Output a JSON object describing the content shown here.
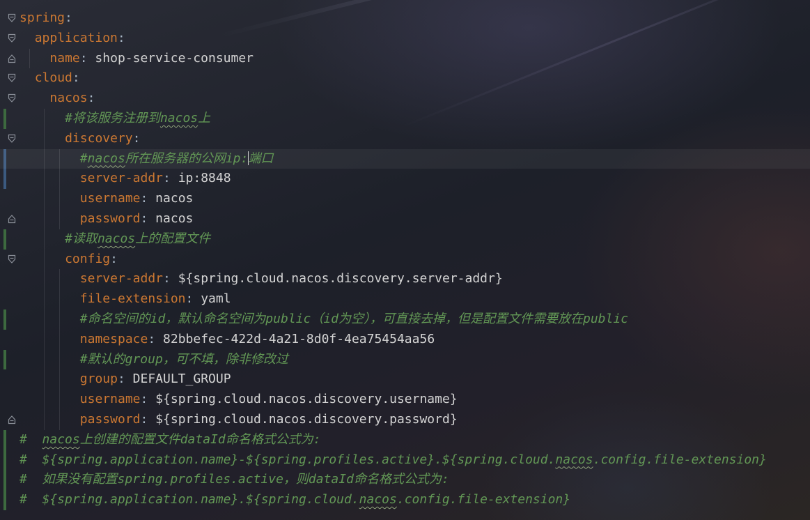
{
  "editor": {
    "language": "yaml",
    "caret_line": 8,
    "lines": [
      {
        "type": "key",
        "indent": 0,
        "key": "spring",
        "value": ""
      },
      {
        "type": "key",
        "indent": 1,
        "key": "application",
        "value": ""
      },
      {
        "type": "key",
        "indent": 2,
        "key": "name",
        "value": "shop-service-consumer"
      },
      {
        "type": "key",
        "indent": 1,
        "key": "cloud",
        "value": ""
      },
      {
        "type": "key",
        "indent": 2,
        "key": "nacos",
        "value": ""
      },
      {
        "type": "comment",
        "indent": 3,
        "text": "#将该服务注册到nacos上"
      },
      {
        "type": "key",
        "indent": 3,
        "key": "discovery",
        "value": ""
      },
      {
        "type": "comment",
        "indent": 4,
        "text": "#nacos所在服务器的公网ip:端口"
      },
      {
        "type": "key",
        "indent": 4,
        "key": "server-addr",
        "value": "ip:8848"
      },
      {
        "type": "key",
        "indent": 4,
        "key": "username",
        "value": "nacos"
      },
      {
        "type": "key",
        "indent": 4,
        "key": "password",
        "value": "nacos"
      },
      {
        "type": "comment",
        "indent": 3,
        "text": "#读取nacos上的配置文件"
      },
      {
        "type": "key",
        "indent": 3,
        "key": "config",
        "value": ""
      },
      {
        "type": "key",
        "indent": 4,
        "key": "server-addr",
        "value": "${spring.cloud.nacos.discovery.server-addr}"
      },
      {
        "type": "key",
        "indent": 4,
        "key": "file-extension",
        "value": "yaml"
      },
      {
        "type": "comment",
        "indent": 4,
        "text": "#命名空间的id，默认命名空间为public（id为空），可直接去掉，但是配置文件需要放在public"
      },
      {
        "type": "key",
        "indent": 4,
        "key": "namespace",
        "value": "82bbefec-422d-4a21-8d0f-4ea75454aa56"
      },
      {
        "type": "comment",
        "indent": 4,
        "text": "#默认的group，可不填，除非修改过"
      },
      {
        "type": "key",
        "indent": 4,
        "key": "group",
        "value": "DEFAULT_GROUP"
      },
      {
        "type": "key",
        "indent": 4,
        "key": "username",
        "value": "${spring.cloud.nacos.discovery.username}"
      },
      {
        "type": "key",
        "indent": 4,
        "key": "password",
        "value": "${spring.cloud.nacos.discovery.password}"
      },
      {
        "type": "comment",
        "indent": 0,
        "text": "#  nacos上创建的配置文件dataId命名格式公式为:"
      },
      {
        "type": "comment",
        "indent": 0,
        "text": "#  ${spring.application.name}-${spring.profiles.active}.${spring.cloud.nacos.config.file-extension}"
      },
      {
        "type": "comment",
        "indent": 0,
        "text": "#  如果没有配置spring.profiles.active，则dataId命名格式公式为:"
      },
      {
        "type": "comment",
        "indent": 0,
        "text": "#  ${spring.application.name}.${spring.cloud.nacos.config.file-extension}"
      }
    ]
  },
  "colors": {
    "key": "#cc7832",
    "value": "#d4d4d4",
    "punctuation": "#a9b7c6",
    "comment": "#629755",
    "background": "#1e2129"
  },
  "icons": {
    "fold_open": "fold-open-icon",
    "fold_close": "fold-close-icon"
  }
}
